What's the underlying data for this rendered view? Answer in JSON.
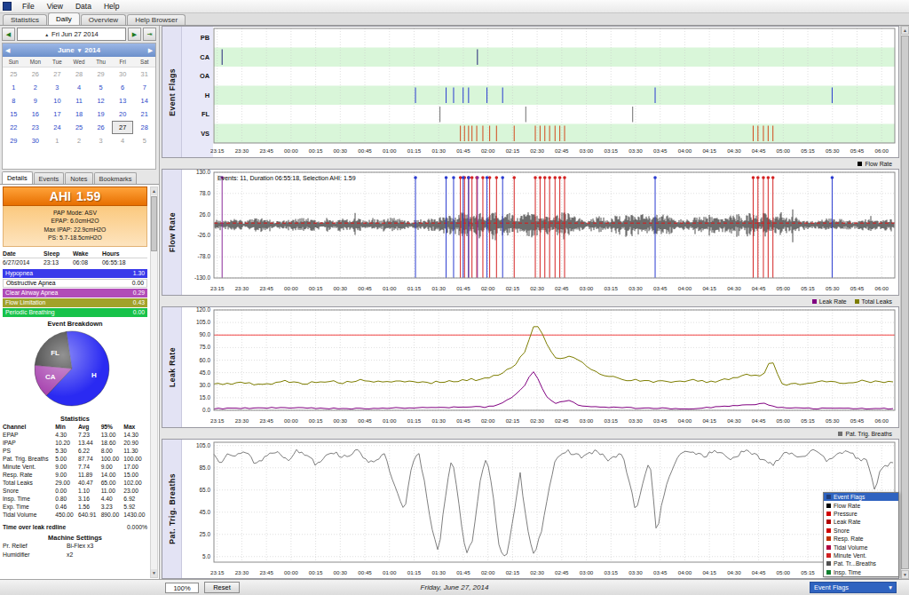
{
  "window": {
    "menu": [
      "File",
      "View",
      "Data",
      "Help"
    ],
    "tabs": [
      "Statistics",
      "Daily",
      "Overview",
      "Help Browser"
    ],
    "active_tab": "Daily"
  },
  "date_nav": {
    "label": "Fri Jun 27 2014"
  },
  "calendar": {
    "month": "June",
    "year": "2014",
    "day_names": [
      "Sun",
      "Mon",
      "Tue",
      "Wed",
      "Thu",
      "Fri",
      "Sat"
    ],
    "weeks": [
      [
        {
          "d": 25,
          "m": 1
        },
        {
          "d": 26,
          "m": 1
        },
        {
          "d": 27,
          "m": 1
        },
        {
          "d": 28,
          "m": 1
        },
        {
          "d": 29,
          "m": 1
        },
        {
          "d": 30,
          "m": 1
        },
        {
          "d": 31,
          "m": 1
        }
      ],
      [
        {
          "d": 1
        },
        {
          "d": 2
        },
        {
          "d": 3
        },
        {
          "d": 4
        },
        {
          "d": 5
        },
        {
          "d": 6
        },
        {
          "d": 7
        }
      ],
      [
        {
          "d": 8
        },
        {
          "d": 9
        },
        {
          "d": 10
        },
        {
          "d": 11
        },
        {
          "d": 12
        },
        {
          "d": 13
        },
        {
          "d": 14
        }
      ],
      [
        {
          "d": 15
        },
        {
          "d": 16
        },
        {
          "d": 17
        },
        {
          "d": 18
        },
        {
          "d": 19
        },
        {
          "d": 20
        },
        {
          "d": 21
        }
      ],
      [
        {
          "d": 22
        },
        {
          "d": 23
        },
        {
          "d": 24
        },
        {
          "d": 25
        },
        {
          "d": 26
        },
        {
          "d": 27,
          "sel": 1
        },
        {
          "d": 28
        }
      ],
      [
        {
          "d": 29
        },
        {
          "d": 30
        },
        {
          "d": 1,
          "m": 1
        },
        {
          "d": 2,
          "m": 1
        },
        {
          "d": 3,
          "m": 1
        },
        {
          "d": 4,
          "m": 1
        },
        {
          "d": 5,
          "m": 1
        }
      ]
    ]
  },
  "side_tabs": [
    "Details",
    "Events",
    "Notes",
    "Bookmarks"
  ],
  "active_side_tab": "Details",
  "details": {
    "ahi_label": "AHI",
    "ahi_value": "1.59",
    "pap_lines": [
      "PAP Mode: ASV",
      "EPAP: 6.0cmH2O",
      "Max IPAP: 22.9cmH2O",
      "PS: 5.7-18.5cmH2O"
    ],
    "session": {
      "headers": [
        "Date",
        "Sleep",
        "Wake",
        "Hours"
      ],
      "values": [
        "6/27/2014",
        "23:13",
        "06:08",
        "06:55:18"
      ]
    },
    "event_rows": [
      {
        "label": "Hypopnea",
        "value": "1.30",
        "bg": "#3a3aea",
        "fg": "#ffffff"
      },
      {
        "label": "Obstructive Apnea",
        "value": "0.00",
        "bg": "#ffffff",
        "fg": "#000000"
      },
      {
        "label": "Clear Airway Apnea",
        "value": "0.29",
        "bg": "#b14cb8",
        "fg": "#ffffff"
      },
      {
        "label": "Flow Limitation",
        "value": "0.43",
        "bg": "#a2a22a",
        "fg": "#ffffff"
      },
      {
        "label": "Periodic Breathing",
        "value": "0.00",
        "bg": "#17c24a",
        "fg": "#ffffff"
      }
    ],
    "breakdown_title": "Event Breakdown",
    "pie": [
      {
        "label": "FL",
        "value": 0.43,
        "color": "#3a3a3a"
      },
      {
        "label": "H",
        "value": 1.3,
        "color": "#2a2af2"
      },
      {
        "label": "CA",
        "value": 0.29,
        "color": "#a845b0"
      }
    ],
    "stats_title": "Statistics",
    "stats_headers": [
      "Channel",
      "Min",
      "Avg",
      "95%",
      "Max"
    ],
    "stats_rows": [
      [
        "EPAP",
        "4.30",
        "7.23",
        "13.00",
        "14.30"
      ],
      [
        "IPAP",
        "10.20",
        "13.44",
        "18.60",
        "20.90"
      ],
      [
        "PS",
        "5.30",
        "6.22",
        "8.00",
        "11.30"
      ],
      [
        "Pat. Trig. Breaths",
        "5.00",
        "87.74",
        "100.00",
        "100.00"
      ],
      [
        "Minute Vent.",
        "9.00",
        "7.74",
        "9.00",
        "17.00"
      ],
      [
        "Resp. Rate",
        "9.00",
        "11.89",
        "14.00",
        "15.00"
      ],
      [
        "Total Leaks",
        "29.00",
        "40.47",
        "65.00",
        "102.00"
      ],
      [
        "Snore",
        "0.00",
        "1.10",
        "11.00",
        "23.00"
      ],
      [
        "Insp. Time",
        "0.80",
        "3.16",
        "4.40",
        "6.92"
      ],
      [
        "Exp. Time",
        "0.46",
        "1.56",
        "3.23",
        "5.92"
      ],
      [
        "Tidal Volume",
        "450.00",
        "640.91",
        "890.00",
        "1430.00"
      ]
    ],
    "leak_redline_label": "Time over leak redline",
    "leak_redline_value": "0.000%",
    "machine_title": "Machine Settings",
    "machine_rows": [
      [
        "Pr. Relief",
        "Bi-Flex x3"
      ],
      [
        "Humidifier",
        "x2"
      ]
    ]
  },
  "charts": {
    "x_ticks": [
      "23:15",
      "23:30",
      "23:45",
      "00:00",
      "00:15",
      "00:30",
      "00:45",
      "01:00",
      "01:15",
      "01:30",
      "01:45",
      "02:00",
      "02:15",
      "02:30",
      "02:45",
      "03:00",
      "03:15",
      "03:30",
      "03:45",
      "04:00",
      "04:15",
      "04:30",
      "04:45",
      "05:00",
      "05:15",
      "05:30",
      "05:45",
      "06:00"
    ],
    "event_flags": {
      "title": "Event Flags",
      "rows": [
        {
          "label": "PB",
          "band": false,
          "color": "#20a020",
          "events": []
        },
        {
          "label": "CA",
          "band": true,
          "color": "#26267a",
          "events": [
            0.012,
            0.387
          ]
        },
        {
          "label": "OA",
          "band": false,
          "color": "#202020",
          "events": []
        },
        {
          "label": "H",
          "band": true,
          "color": "#2a3bd0",
          "events": [
            0.296,
            0.341,
            0.352,
            0.366,
            0.374,
            0.401,
            0.424,
            0.648,
            0.908
          ]
        },
        {
          "label": "FL",
          "band": false,
          "color": "#6f6f6f",
          "events": [
            0.332,
            0.458,
            0.615
          ]
        },
        {
          "label": "VS",
          "band": true,
          "color": "#d2491c",
          "events": [
            0.362,
            0.368,
            0.374,
            0.379,
            0.386,
            0.395,
            0.405,
            0.415,
            0.441,
            0.472,
            0.479,
            0.486,
            0.493,
            0.501,
            0.508,
            0.515,
            0.792,
            0.799,
            0.807,
            0.814,
            0.821
          ]
        }
      ]
    },
    "flow": {
      "title": "Flow Rate",
      "info": "Events: 11, Duration 06:55:18, Selection AHI: 1.59",
      "legend": [
        {
          "label": "Flow Rate",
          "color": "#000000"
        }
      ],
      "y_ticks": [
        130,
        78,
        26,
        -26,
        -78,
        -130
      ],
      "ymin": -130,
      "ymax": 130,
      "baseline": 5,
      "baseline_color": "#ff0000",
      "envelope": [
        [
          0,
          16
        ],
        [
          0.33,
          17
        ],
        [
          0.35,
          30
        ],
        [
          0.52,
          30
        ],
        [
          0.54,
          16
        ],
        [
          0.6,
          26
        ],
        [
          0.67,
          26
        ],
        [
          0.69,
          15
        ],
        [
          0.79,
          30
        ],
        [
          0.84,
          30
        ],
        [
          0.86,
          15
        ],
        [
          1,
          15
        ]
      ],
      "marker_colors": {
        "h": "#2a3bd0",
        "vs": "#d42222",
        "ca": "#8a2a9a"
      }
    },
    "leak": {
      "title": "Leak Rate",
      "legend": [
        {
          "label": "Leak Rate",
          "color": "#800080"
        },
        {
          "label": "Total Leaks",
          "color": "#7d7d00"
        }
      ],
      "y_ticks": [
        120,
        105,
        90,
        75,
        60,
        45,
        30,
        15,
        0
      ],
      "ymin": 0,
      "ymax": 120,
      "redline": 90,
      "total_leaks": [
        [
          0,
          31
        ],
        [
          0.04,
          33
        ],
        [
          0.07,
          30
        ],
        [
          0.1,
          35
        ],
        [
          0.13,
          32
        ],
        [
          0.16,
          35
        ],
        [
          0.19,
          33
        ],
        [
          0.22,
          36
        ],
        [
          0.25,
          33
        ],
        [
          0.28,
          35
        ],
        [
          0.31,
          33
        ],
        [
          0.34,
          34
        ],
        [
          0.37,
          36
        ],
        [
          0.4,
          38
        ],
        [
          0.42,
          44
        ],
        [
          0.44,
          52
        ],
        [
          0.455,
          68
        ],
        [
          0.465,
          88
        ],
        [
          0.472,
          105
        ],
        [
          0.48,
          96
        ],
        [
          0.49,
          76
        ],
        [
          0.5,
          63
        ],
        [
          0.51,
          60
        ],
        [
          0.525,
          66
        ],
        [
          0.54,
          58
        ],
        [
          0.56,
          46
        ],
        [
          0.58,
          41
        ],
        [
          0.6,
          37
        ],
        [
          0.63,
          35
        ],
        [
          0.66,
          34
        ],
        [
          0.7,
          36
        ],
        [
          0.73,
          34
        ],
        [
          0.76,
          38
        ],
        [
          0.78,
          43
        ],
        [
          0.8,
          41
        ],
        [
          0.81,
          46
        ],
        [
          0.818,
          60
        ],
        [
          0.825,
          52
        ],
        [
          0.832,
          31
        ],
        [
          0.86,
          32
        ],
        [
          0.89,
          34
        ],
        [
          0.92,
          33
        ],
        [
          0.95,
          35
        ],
        [
          0.98,
          34
        ],
        [
          1,
          33
        ]
      ],
      "leak_rate": [
        [
          0,
          2
        ],
        [
          0.1,
          3
        ],
        [
          0.2,
          2
        ],
        [
          0.3,
          3
        ],
        [
          0.4,
          4
        ],
        [
          0.42,
          7
        ],
        [
          0.44,
          16
        ],
        [
          0.455,
          28
        ],
        [
          0.468,
          47
        ],
        [
          0.476,
          38
        ],
        [
          0.486,
          18
        ],
        [
          0.5,
          8
        ],
        [
          0.52,
          12
        ],
        [
          0.54,
          5
        ],
        [
          0.6,
          3
        ],
        [
          0.7,
          2
        ],
        [
          0.78,
          6
        ],
        [
          0.81,
          8
        ],
        [
          0.83,
          3
        ],
        [
          0.9,
          2
        ],
        [
          1,
          2
        ]
      ]
    },
    "ptb": {
      "title": "Pat. Trig. Breaths",
      "legend": [
        {
          "label": "Pat. Trig. Breaths",
          "color": "#707070"
        }
      ],
      "y_ticks": [
        105,
        85,
        65,
        45,
        25,
        5
      ],
      "ymin": 0,
      "ymax": 108,
      "series": [
        [
          0,
          97
        ],
        [
          0.01,
          90
        ],
        [
          0.02,
          100
        ],
        [
          0.03,
          95
        ],
        [
          0.05,
          100
        ],
        [
          0.06,
          88
        ],
        [
          0.08,
          97
        ],
        [
          0.09,
          100
        ],
        [
          0.11,
          93
        ],
        [
          0.12,
          100
        ],
        [
          0.14,
          96
        ],
        [
          0.15,
          88
        ],
        [
          0.17,
          100
        ],
        [
          0.19,
          95
        ],
        [
          0.21,
          100
        ],
        [
          0.23,
          90
        ],
        [
          0.25,
          97
        ],
        [
          0.27,
          60
        ],
        [
          0.28,
          45
        ],
        [
          0.29,
          85
        ],
        [
          0.3,
          100
        ],
        [
          0.31,
          70
        ],
        [
          0.32,
          30
        ],
        [
          0.33,
          10
        ],
        [
          0.34,
          60
        ],
        [
          0.35,
          95
        ],
        [
          0.36,
          50
        ],
        [
          0.37,
          8
        ],
        [
          0.38,
          20
        ],
        [
          0.39,
          70
        ],
        [
          0.4,
          95
        ],
        [
          0.41,
          60
        ],
        [
          0.42,
          10
        ],
        [
          0.43,
          5
        ],
        [
          0.44,
          40
        ],
        [
          0.45,
          80
        ],
        [
          0.46,
          30
        ],
        [
          0.47,
          8
        ],
        [
          0.48,
          25
        ],
        [
          0.49,
          60
        ],
        [
          0.5,
          90
        ],
        [
          0.52,
          100
        ],
        [
          0.54,
          95
        ],
        [
          0.56,
          100
        ],
        [
          0.58,
          92
        ],
        [
          0.6,
          98
        ],
        [
          0.62,
          45
        ],
        [
          0.63,
          70
        ],
        [
          0.64,
          95
        ],
        [
          0.65,
          25
        ],
        [
          0.66,
          60
        ],
        [
          0.68,
          95
        ],
        [
          0.7,
          100
        ],
        [
          0.72,
          96
        ],
        [
          0.74,
          100
        ],
        [
          0.76,
          93
        ],
        [
          0.78,
          100
        ],
        [
          0.8,
          95
        ],
        [
          0.82,
          88
        ],
        [
          0.84,
          100
        ],
        [
          0.86,
          95
        ],
        [
          0.88,
          100
        ],
        [
          0.9,
          92
        ],
        [
          0.92,
          100
        ],
        [
          0.94,
          96
        ],
        [
          0.96,
          90
        ],
        [
          0.97,
          65
        ],
        [
          0.98,
          85
        ],
        [
          1,
          90
        ]
      ]
    },
    "overlay_legend": [
      {
        "label": "Event Flags",
        "color": "#1f3d7a",
        "selected": true
      },
      {
        "label": "Flow Rate",
        "color": "#000000"
      },
      {
        "label": "Pressure",
        "color": "#d00000"
      },
      {
        "label": "Leak Rate",
        "color": "#b00000"
      },
      {
        "label": "Snore",
        "color": "#d00000"
      },
      {
        "label": "Resp. Rate",
        "color": "#c03000"
      },
      {
        "label": "Tidal Volume",
        "color": "#b00040"
      },
      {
        "label": "Minute Vent.",
        "color": "#d02020"
      },
      {
        "label": "Pat. Tr...Breaths",
        "color": "#505050"
      },
      {
        "label": "Insp. Time",
        "color": "#108030"
      }
    ]
  },
  "status_bar": {
    "zoom": "100%",
    "reset": "Reset",
    "date_label": "Friday, June 27, 2014",
    "channel": "Event Flags"
  }
}
